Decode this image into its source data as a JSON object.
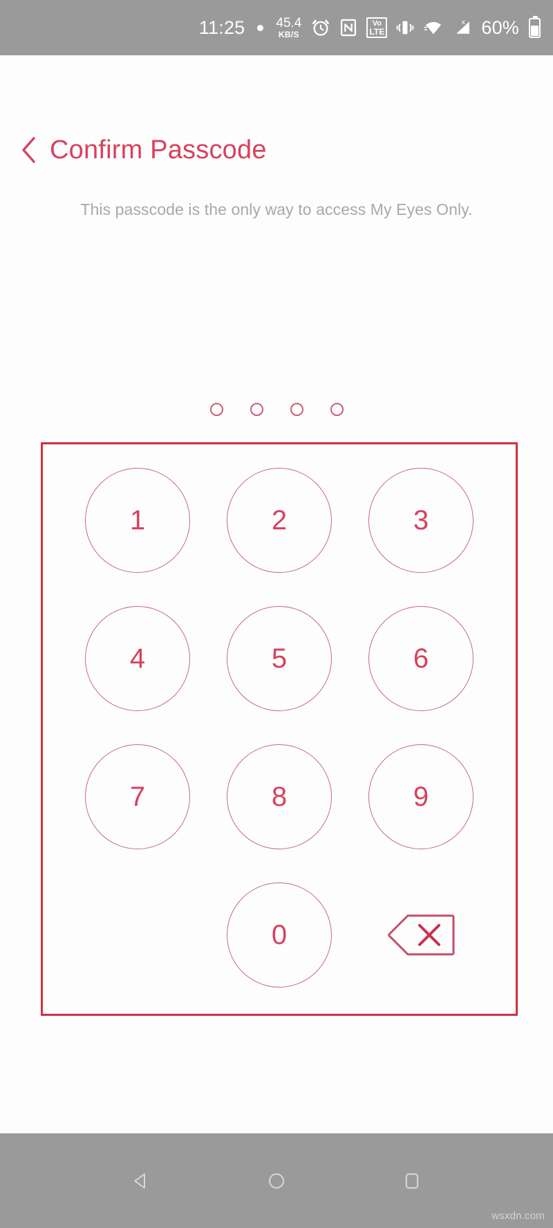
{
  "status_bar": {
    "time": "11:25",
    "dot_icon": "recording-dot-icon",
    "net_speed_value": "45.4",
    "net_speed_unit": "KB/S",
    "icons": [
      "alarm-icon",
      "nfc-icon",
      "volte-icon",
      "vibrate-icon",
      "wifi-icon",
      "signal-icon"
    ],
    "volte_top": "Vo",
    "volte_bottom": "LTE",
    "battery_percent": "60%",
    "background": "#9a9a9a",
    "foreground": "#ffffff"
  },
  "header": {
    "back_label": "back-chevron",
    "title": "Confirm Passcode",
    "accent_color": "#d8415c"
  },
  "subtitle": {
    "text": "This passcode is the only way to access My Eyes Only.",
    "color": "#a8a8a8"
  },
  "passcode": {
    "length": 4,
    "entered": 0,
    "dots": [
      "",
      "",
      "",
      ""
    ],
    "dot_color": "#c75f78"
  },
  "keypad": {
    "border_color": "#d22f3f",
    "key_border_color": "#c9697f",
    "key_text_color": "#d8415c",
    "rows": [
      {
        "keys": [
          {
            "label": "1",
            "name": "keypad-key-1"
          },
          {
            "label": "2",
            "name": "keypad-key-2"
          },
          {
            "label": "3",
            "name": "keypad-key-3"
          }
        ]
      },
      {
        "keys": [
          {
            "label": "4",
            "name": "keypad-key-4"
          },
          {
            "label": "5",
            "name": "keypad-key-5"
          },
          {
            "label": "6",
            "name": "keypad-key-6"
          }
        ]
      },
      {
        "keys": [
          {
            "label": "7",
            "name": "keypad-key-7"
          },
          {
            "label": "8",
            "name": "keypad-key-8"
          },
          {
            "label": "9",
            "name": "keypad-key-9"
          }
        ]
      },
      {
        "keys": [
          {
            "label": "",
            "name": "keypad-blank"
          },
          {
            "label": "0",
            "name": "keypad-key-0"
          },
          {
            "label": "backspace-icon",
            "name": "keypad-backspace"
          }
        ]
      }
    ],
    "key_1": "1",
    "key_2": "2",
    "key_3": "3",
    "key_4": "4",
    "key_5": "5",
    "key_6": "6",
    "key_7": "7",
    "key_8": "8",
    "key_9": "9",
    "key_0": "0",
    "backspace_icon": "backspace-delete-icon"
  },
  "nav_bar": {
    "buttons": [
      "back-triangle-icon",
      "home-circle-icon",
      "recents-square-icon"
    ],
    "background": "#9a9a9a"
  },
  "watermark": {
    "text": "wsxdn.com"
  }
}
